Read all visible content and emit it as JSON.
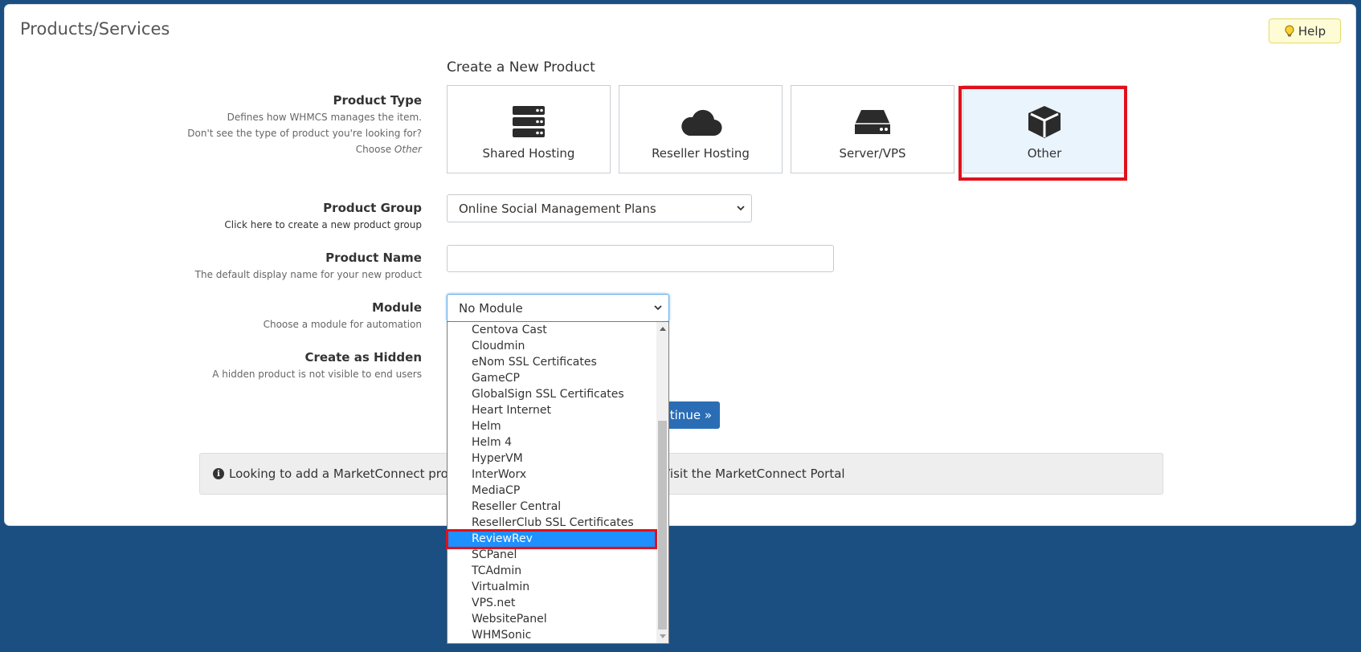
{
  "page": {
    "title": "Products/Services",
    "help_label": "Help",
    "help_icon": "lightbulb-icon"
  },
  "form": {
    "heading": "Create a New Product",
    "product_type": {
      "label": "Product Type",
      "desc1": "Defines how WHMCS manages the item.",
      "desc2": "Don't see the type of product you're looking for?",
      "desc3_prefix": "Choose ",
      "desc3_em": "Other",
      "options": [
        {
          "label": "Shared Hosting",
          "icon": "server-stack-icon",
          "selected": false
        },
        {
          "label": "Reseller Hosting",
          "icon": "cloud-icon",
          "selected": false
        },
        {
          "label": "Server/VPS",
          "icon": "hard-drive-icon",
          "selected": false
        },
        {
          "label": "Other",
          "icon": "cube-icon",
          "selected": true
        }
      ]
    },
    "product_group": {
      "label": "Product Group",
      "link": "Click here to create a new product group",
      "selected": "Online Social Management Plans"
    },
    "product_name": {
      "label": "Product Name",
      "desc": "The default display name for your new product",
      "value": ""
    },
    "module": {
      "label": "Module",
      "desc": "Choose a module for automation",
      "selected": "No Module"
    },
    "hidden": {
      "label": "Create as Hidden",
      "desc": "A hidden product is not visible to end users"
    },
    "continue_label": "ntinue »"
  },
  "info": {
    "left": "Looking to add a MarketConnect product",
    "right": "Visit the MarketConnect Portal"
  },
  "dropdown": {
    "items": [
      "Centova Cast",
      "Cloudmin",
      "eNom SSL Certificates",
      "GameCP",
      "GlobalSign SSL Certificates",
      "Heart Internet",
      "Helm",
      "Helm 4",
      "HyperVM",
      "InterWorx",
      "MediaCP",
      "Reseller Central",
      "ResellerClub SSL Certificates",
      "ReviewRev",
      "SCPanel",
      "TCAdmin",
      "Virtualmin",
      "VPS.net",
      "WebsitePanel",
      "WHMSonic"
    ],
    "selected_index": 13
  },
  "colors": {
    "background": "#1b4f82",
    "accent": "#2a6db5",
    "highlight": "#e0111c",
    "dropdown_selected": "#1e90ff"
  }
}
